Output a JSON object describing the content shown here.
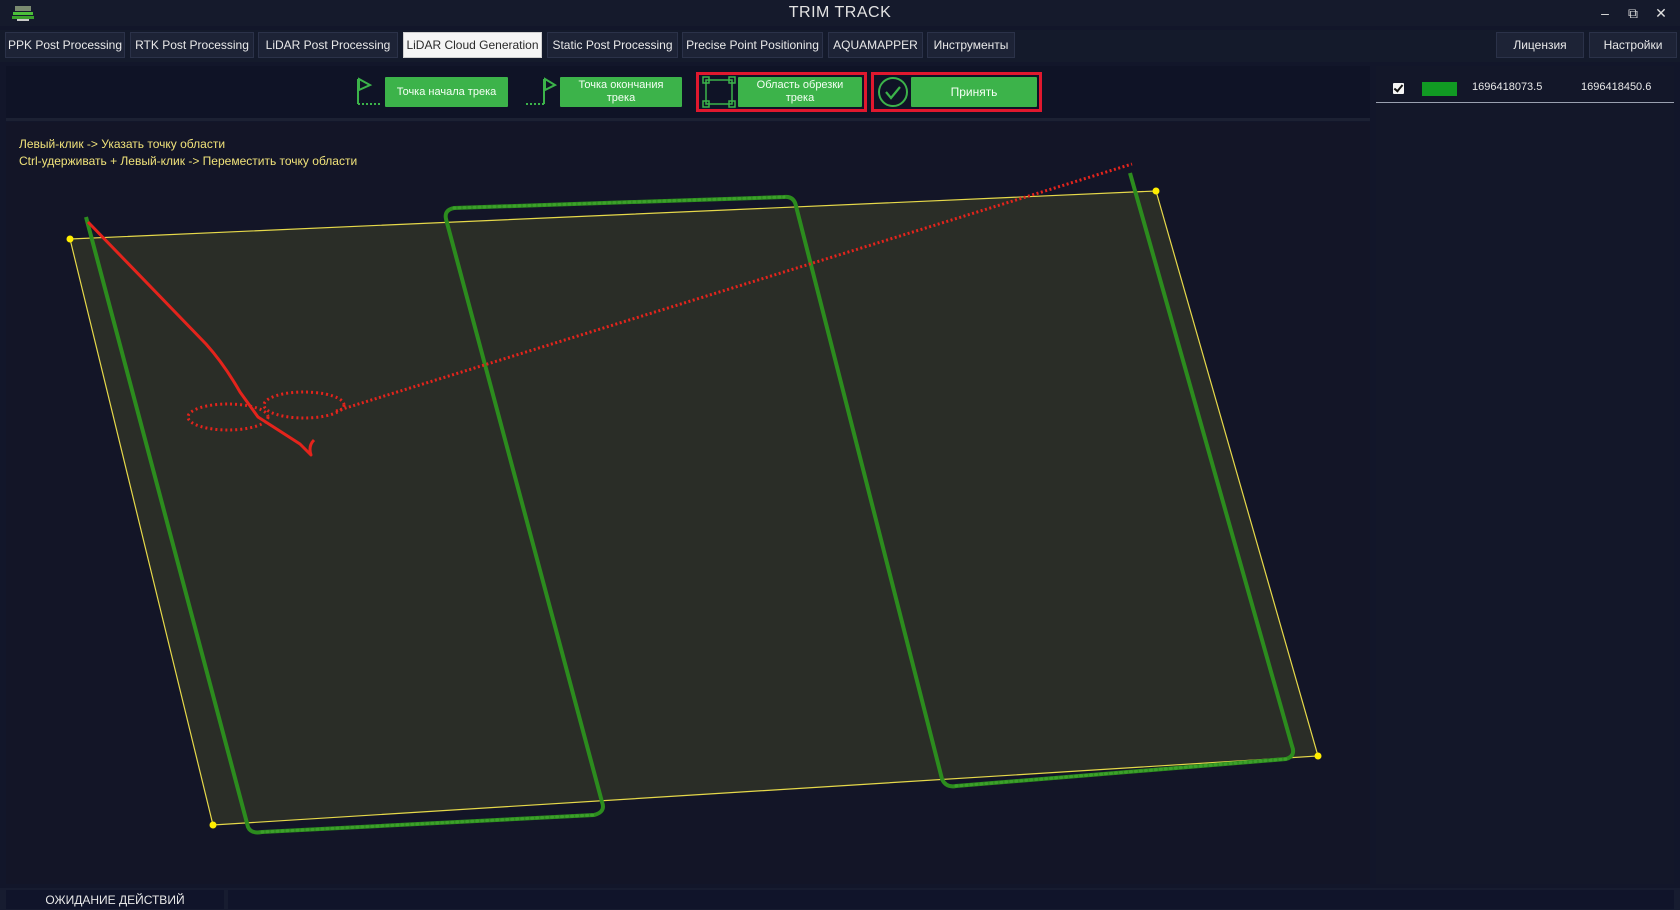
{
  "window": {
    "title": "TRIM TRACK",
    "controls": {
      "minimize": "–",
      "restore": "⧉",
      "close": "✕"
    }
  },
  "tabs": [
    {
      "label": "PPK Post Processing"
    },
    {
      "label": "RTK Post Processing"
    },
    {
      "label": "LiDAR Post Processing"
    },
    {
      "label": "LiDAR Cloud Generation",
      "active": true
    },
    {
      "label": "Static Post Processing"
    },
    {
      "label": "Precise Point Positioning"
    },
    {
      "label": "AQUAMAPPER"
    },
    {
      "label": "Инструменты"
    }
  ],
  "right_tabs": {
    "license": "Лицензия",
    "settings": "Настройки"
  },
  "toolbar": {
    "start_point": "Точка начала трека",
    "end_point": "Точка окончания трека",
    "crop_area": "Область обрезки трека",
    "accept": "Принять",
    "icons": [
      "flag-start-icon",
      "flag-end-icon",
      "crop-area-icon",
      "checkmark-circle-icon"
    ],
    "highlight_color": "#e0182e",
    "button_color": "#3cb34a"
  },
  "hints": {
    "line1": "Левый-клик -> Указать точку области",
    "line2": "Ctrl-удерживать + Левый-клик -> Переместить точку области"
  },
  "tracks": [
    {
      "checked": true,
      "color": "#119a23",
      "start": "1696418073.5",
      "end": "1696418450.6"
    }
  ],
  "colors": {
    "track_inside": "#2c8c1e",
    "track_outside": "#e4241c",
    "crop_polygon": "#e6d94a",
    "crop_vertex": "#ffee00"
  },
  "status": {
    "text": "ОЖИДАНИЕ ДЕЙСТВИЙ"
  }
}
